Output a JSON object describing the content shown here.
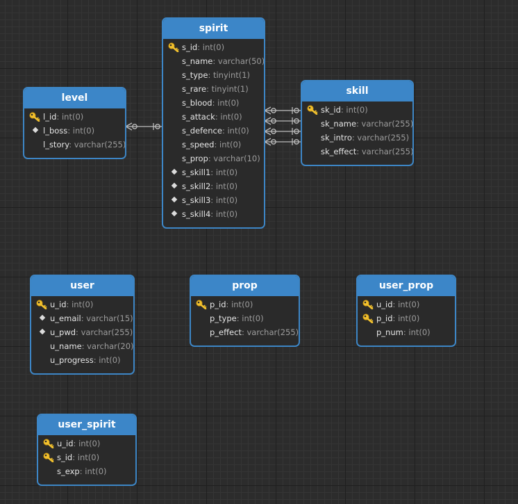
{
  "tables": {
    "spirit": {
      "name": "spirit",
      "fields": [
        {
          "name": "s_id",
          "type": ": int(0)",
          "icon": "key"
        },
        {
          "name": "s_name",
          "type": ": varchar(50)",
          "icon": "none"
        },
        {
          "name": "s_type",
          "type": ": tinyint(1)",
          "icon": "none"
        },
        {
          "name": "s_rare",
          "type": ": tinyint(1)",
          "icon": "none"
        },
        {
          "name": "s_blood",
          "type": ": int(0)",
          "icon": "none"
        },
        {
          "name": "s_attack",
          "type": ": int(0)",
          "icon": "none"
        },
        {
          "name": "s_defence",
          "type": ": int(0)",
          "icon": "none"
        },
        {
          "name": "s_speed",
          "type": ": int(0)",
          "icon": "none"
        },
        {
          "name": "s_prop",
          "type": ": varchar(10)",
          "icon": "none"
        },
        {
          "name": "s_skill1",
          "type": ": int(0)",
          "icon": "diamond"
        },
        {
          "name": "s_skill2",
          "type": ": int(0)",
          "icon": "diamond"
        },
        {
          "name": "s_skill3",
          "type": ": int(0)",
          "icon": "diamond"
        },
        {
          "name": "s_skill4",
          "type": ": int(0)",
          "icon": "diamond"
        }
      ]
    },
    "level": {
      "name": "level",
      "fields": [
        {
          "name": "l_id",
          "type": ": int(0)",
          "icon": "key"
        },
        {
          "name": "l_boss",
          "type": ": int(0)",
          "icon": "diamond"
        },
        {
          "name": "l_story",
          "type": ": varchar(255)",
          "icon": "none"
        }
      ]
    },
    "skill": {
      "name": "skill",
      "fields": [
        {
          "name": "sk_id",
          "type": ": int(0)",
          "icon": "key"
        },
        {
          "name": "sk_name",
          "type": ": varchar(255)",
          "icon": "none"
        },
        {
          "name": "sk_intro",
          "type": ": varchar(255)",
          "icon": "none"
        },
        {
          "name": "sk_effect",
          "type": ": varchar(255)",
          "icon": "none"
        }
      ]
    },
    "user": {
      "name": "user",
      "fields": [
        {
          "name": "u_id",
          "type": ": int(0)",
          "icon": "key"
        },
        {
          "name": "u_email",
          "type": ": varchar(15)",
          "icon": "diamond"
        },
        {
          "name": "u_pwd",
          "type": ": varchar(255)",
          "icon": "diamond"
        },
        {
          "name": "u_name",
          "type": ": varchar(20)",
          "icon": "none"
        },
        {
          "name": "u_progress",
          "type": ": int(0)",
          "icon": "none"
        }
      ]
    },
    "prop": {
      "name": "prop",
      "fields": [
        {
          "name": "p_id",
          "type": ": int(0)",
          "icon": "key"
        },
        {
          "name": "p_type",
          "type": ": int(0)",
          "icon": "none"
        },
        {
          "name": "p_effect",
          "type": ": varchar(255)",
          "icon": "none"
        }
      ]
    },
    "user_prop": {
      "name": "user_prop",
      "fields": [
        {
          "name": "u_id",
          "type": ": int(0)",
          "icon": "key"
        },
        {
          "name": "p_id",
          "type": ": int(0)",
          "icon": "key"
        },
        {
          "name": "p_num",
          "type": ": int(0)",
          "icon": "none"
        }
      ]
    },
    "user_spirit": {
      "name": "user_spirit",
      "fields": [
        {
          "name": "u_id",
          "type": ": int(0)",
          "icon": "key"
        },
        {
          "name": "s_id",
          "type": ": int(0)",
          "icon": "key"
        },
        {
          "name": "s_exp",
          "type": ": int(0)",
          "icon": "none"
        }
      ]
    }
  },
  "relationships": [
    {
      "from": "level",
      "to": "spirit",
      "notation": "zero-or-many to zero-or-one"
    },
    {
      "from": "spirit",
      "to": "skill",
      "field": "s_skill1",
      "notation": "zero-or-many to zero-or-one"
    },
    {
      "from": "spirit",
      "to": "skill",
      "field": "s_skill2",
      "notation": "zero-or-many to zero-or-one"
    },
    {
      "from": "spirit",
      "to": "skill",
      "field": "s_skill3",
      "notation": "zero-or-many to zero-or-one"
    },
    {
      "from": "spirit",
      "to": "skill",
      "field": "s_skill4",
      "notation": "zero-or-many to zero-or-one"
    }
  ],
  "colors": {
    "background": "#2c2c2c",
    "table_header": "#3c86c8",
    "table_border": "#3d86c6",
    "table_body": "#2a2a2a",
    "field_name": "#e6e6e6",
    "field_type": "#9d9d9d",
    "key_icon": "#f2c12e",
    "connector": "#bdbdbd"
  }
}
